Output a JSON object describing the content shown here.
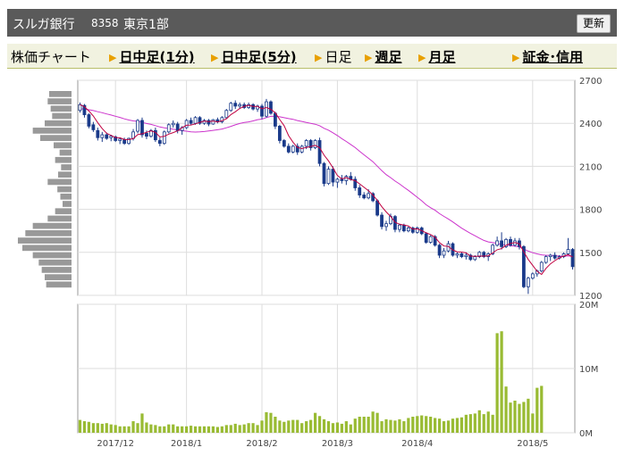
{
  "header": {
    "company": "スルガ銀行",
    "code": "8358",
    "market": "東京1部",
    "refresh_label": "更新"
  },
  "tabs": [
    {
      "label": "株価チャート",
      "link": false
    },
    {
      "label": "日中足(1分)",
      "link": true
    },
    {
      "label": "日中足(5分)",
      "link": true
    },
    {
      "label": "日足",
      "link": false
    },
    {
      "label": "週足",
      "link": true
    },
    {
      "label": "月足",
      "link": true
    },
    {
      "label": "証金･信用",
      "link": true
    }
  ],
  "colors": {
    "up": "#ffffff",
    "down": "#1a3a8a",
    "candle_border": "#1a3a8a",
    "ma_short": "#c00040",
    "ma_long": "#cc33cc",
    "volume": "#99bb33",
    "volume_profile": "#999999"
  },
  "chart_data": [
    {
      "type": "candlestick",
      "price_axis": {
        "min": 1200,
        "max": 2700,
        "ticks": [
          "2700",
          "2400",
          "2100",
          "1800",
          "1500",
          "1200"
        ]
      },
      "x_tick_labels": [
        "2017/12",
        "2018/1",
        "2018/2",
        "2018/3",
        "2018/4",
        "2018/5"
      ],
      "x_tick_positions": [
        8,
        24,
        41,
        58,
        76,
        102
      ],
      "candles": [
        {
          "o": 2490,
          "h": 2545,
          "l": 2475,
          "c": 2530
        },
        {
          "o": 2525,
          "h": 2535,
          "l": 2440,
          "c": 2460
        },
        {
          "o": 2460,
          "h": 2470,
          "l": 2365,
          "c": 2380
        },
        {
          "o": 2390,
          "h": 2410,
          "l": 2340,
          "c": 2355
        },
        {
          "o": 2350,
          "h": 2370,
          "l": 2280,
          "c": 2300
        },
        {
          "o": 2300,
          "h": 2340,
          "l": 2270,
          "c": 2320
        },
        {
          "o": 2320,
          "h": 2335,
          "l": 2285,
          "c": 2295
        },
        {
          "o": 2300,
          "h": 2320,
          "l": 2275,
          "c": 2310
        },
        {
          "o": 2305,
          "h": 2315,
          "l": 2270,
          "c": 2280
        },
        {
          "o": 2280,
          "h": 2300,
          "l": 2255,
          "c": 2290
        },
        {
          "o": 2285,
          "h": 2300,
          "l": 2250,
          "c": 2260
        },
        {
          "o": 2260,
          "h": 2300,
          "l": 2250,
          "c": 2295
        },
        {
          "o": 2295,
          "h": 2360,
          "l": 2280,
          "c": 2340
        },
        {
          "o": 2345,
          "h": 2430,
          "l": 2330,
          "c": 2420
        },
        {
          "o": 2420,
          "h": 2440,
          "l": 2300,
          "c": 2320
        },
        {
          "o": 2330,
          "h": 2350,
          "l": 2290,
          "c": 2310
        },
        {
          "o": 2310,
          "h": 2360,
          "l": 2300,
          "c": 2350
        },
        {
          "o": 2350,
          "h": 2370,
          "l": 2270,
          "c": 2285
        },
        {
          "o": 2280,
          "h": 2300,
          "l": 2240,
          "c": 2260
        },
        {
          "o": 2260,
          "h": 2350,
          "l": 2250,
          "c": 2340
        },
        {
          "o": 2340,
          "h": 2400,
          "l": 2330,
          "c": 2390
        },
        {
          "o": 2390,
          "h": 2420,
          "l": 2370,
          "c": 2400
        },
        {
          "o": 2395,
          "h": 2410,
          "l": 2330,
          "c": 2350
        },
        {
          "o": 2350,
          "h": 2380,
          "l": 2320,
          "c": 2370
        },
        {
          "o": 2370,
          "h": 2430,
          "l": 2360,
          "c": 2420
        },
        {
          "o": 2420,
          "h": 2440,
          "l": 2390,
          "c": 2400
        },
        {
          "o": 2400,
          "h": 2450,
          "l": 2390,
          "c": 2440
        },
        {
          "o": 2440,
          "h": 2450,
          "l": 2390,
          "c": 2400
        },
        {
          "o": 2400,
          "h": 2430,
          "l": 2390,
          "c": 2420
        },
        {
          "o": 2420,
          "h": 2430,
          "l": 2380,
          "c": 2395
        },
        {
          "o": 2395,
          "h": 2430,
          "l": 2390,
          "c": 2425
        },
        {
          "o": 2425,
          "h": 2440,
          "l": 2400,
          "c": 2410
        },
        {
          "o": 2410,
          "h": 2450,
          "l": 2400,
          "c": 2440
        },
        {
          "o": 2440,
          "h": 2500,
          "l": 2430,
          "c": 2490
        },
        {
          "o": 2490,
          "h": 2550,
          "l": 2480,
          "c": 2540
        },
        {
          "o": 2540,
          "h": 2560,
          "l": 2500,
          "c": 2520
        },
        {
          "o": 2520,
          "h": 2545,
          "l": 2500,
          "c": 2530
        },
        {
          "o": 2530,
          "h": 2545,
          "l": 2500,
          "c": 2510
        },
        {
          "o": 2510,
          "h": 2545,
          "l": 2500,
          "c": 2530
        },
        {
          "o": 2530,
          "h": 2540,
          "l": 2490,
          "c": 2500
        },
        {
          "o": 2500,
          "h": 2530,
          "l": 2480,
          "c": 2520
        },
        {
          "o": 2520,
          "h": 2535,
          "l": 2430,
          "c": 2450
        },
        {
          "o": 2450,
          "h": 2570,
          "l": 2440,
          "c": 2550
        },
        {
          "o": 2550,
          "h": 2560,
          "l": 2460,
          "c": 2470
        },
        {
          "o": 2470,
          "h": 2480,
          "l": 2360,
          "c": 2380
        },
        {
          "o": 2380,
          "h": 2390,
          "l": 2260,
          "c": 2280
        },
        {
          "o": 2280,
          "h": 2290,
          "l": 2230,
          "c": 2240
        },
        {
          "o": 2240,
          "h": 2260,
          "l": 2190,
          "c": 2200
        },
        {
          "o": 2200,
          "h": 2250,
          "l": 2190,
          "c": 2240
        },
        {
          "o": 2240,
          "h": 2260,
          "l": 2180,
          "c": 2200
        },
        {
          "o": 2200,
          "h": 2250,
          "l": 2190,
          "c": 2240
        },
        {
          "o": 2240,
          "h": 2290,
          "l": 2220,
          "c": 2280
        },
        {
          "o": 2280,
          "h": 2290,
          "l": 2210,
          "c": 2230
        },
        {
          "o": 2230,
          "h": 2290,
          "l": 2220,
          "c": 2280
        },
        {
          "o": 2280,
          "h": 2300,
          "l": 2100,
          "c": 2120
        },
        {
          "o": 2120,
          "h": 2130,
          "l": 1960,
          "c": 1980
        },
        {
          "o": 1980,
          "h": 2100,
          "l": 1970,
          "c": 2080
        },
        {
          "o": 2080,
          "h": 2100,
          "l": 1960,
          "c": 1990
        },
        {
          "o": 1990,
          "h": 2020,
          "l": 1950,
          "c": 2010
        },
        {
          "o": 2010,
          "h": 2040,
          "l": 1980,
          "c": 2000
        },
        {
          "o": 2000,
          "h": 2040,
          "l": 1970,
          "c": 2030
        },
        {
          "o": 2030,
          "h": 2060,
          "l": 2000,
          "c": 2010
        },
        {
          "o": 2010,
          "h": 2030,
          "l": 1930,
          "c": 1950
        },
        {
          "o": 1950,
          "h": 1970,
          "l": 1880,
          "c": 1900
        },
        {
          "o": 1900,
          "h": 1920,
          "l": 1870,
          "c": 1880
        },
        {
          "o": 1880,
          "h": 1940,
          "l": 1870,
          "c": 1910
        },
        {
          "o": 1910,
          "h": 1920,
          "l": 1850,
          "c": 1860
        },
        {
          "o": 1860,
          "h": 1870,
          "l": 1750,
          "c": 1760
        },
        {
          "o": 1760,
          "h": 1780,
          "l": 1660,
          "c": 1680
        },
        {
          "o": 1680,
          "h": 1720,
          "l": 1650,
          "c": 1700
        },
        {
          "o": 1700,
          "h": 1770,
          "l": 1690,
          "c": 1750
        },
        {
          "o": 1750,
          "h": 1760,
          "l": 1640,
          "c": 1660
        },
        {
          "o": 1660,
          "h": 1700,
          "l": 1640,
          "c": 1690
        },
        {
          "o": 1690,
          "h": 1700,
          "l": 1640,
          "c": 1650
        },
        {
          "o": 1650,
          "h": 1680,
          "l": 1640,
          "c": 1670
        },
        {
          "o": 1670,
          "h": 1680,
          "l": 1630,
          "c": 1640
        },
        {
          "o": 1640,
          "h": 1680,
          "l": 1630,
          "c": 1670
        },
        {
          "o": 1670,
          "h": 1680,
          "l": 1620,
          "c": 1630
        },
        {
          "o": 1630,
          "h": 1640,
          "l": 1560,
          "c": 1570
        },
        {
          "o": 1570,
          "h": 1620,
          "l": 1560,
          "c": 1610
        },
        {
          "o": 1610,
          "h": 1620,
          "l": 1540,
          "c": 1550
        },
        {
          "o": 1550,
          "h": 1560,
          "l": 1460,
          "c": 1480
        },
        {
          "o": 1480,
          "h": 1530,
          "l": 1460,
          "c": 1510
        },
        {
          "o": 1510,
          "h": 1580,
          "l": 1500,
          "c": 1560
        },
        {
          "o": 1560,
          "h": 1570,
          "l": 1470,
          "c": 1480
        },
        {
          "o": 1480,
          "h": 1500,
          "l": 1460,
          "c": 1490
        },
        {
          "o": 1490,
          "h": 1500,
          "l": 1460,
          "c": 1470
        },
        {
          "o": 1470,
          "h": 1500,
          "l": 1450,
          "c": 1480
        },
        {
          "o": 1480,
          "h": 1490,
          "l": 1440,
          "c": 1450
        },
        {
          "o": 1450,
          "h": 1480,
          "l": 1440,
          "c": 1470
        },
        {
          "o": 1470,
          "h": 1510,
          "l": 1460,
          "c": 1500
        },
        {
          "o": 1500,
          "h": 1510,
          "l": 1460,
          "c": 1470
        },
        {
          "o": 1470,
          "h": 1500,
          "l": 1440,
          "c": 1490
        },
        {
          "o": 1490,
          "h": 1560,
          "l": 1480,
          "c": 1550
        },
        {
          "o": 1550,
          "h": 1610,
          "l": 1540,
          "c": 1580
        },
        {
          "o": 1580,
          "h": 1640,
          "l": 1520,
          "c": 1540
        },
        {
          "o": 1540,
          "h": 1600,
          "l": 1530,
          "c": 1590
        },
        {
          "o": 1590,
          "h": 1610,
          "l": 1540,
          "c": 1550
        },
        {
          "o": 1550,
          "h": 1600,
          "l": 1540,
          "c": 1580
        },
        {
          "o": 1580,
          "h": 1600,
          "l": 1520,
          "c": 1540
        },
        {
          "o": 1540,
          "h": 1550,
          "l": 1250,
          "c": 1260
        },
        {
          "o": 1260,
          "h": 1330,
          "l": 1210,
          "c": 1320
        },
        {
          "o": 1320,
          "h": 1360,
          "l": 1310,
          "c": 1350
        },
        {
          "o": 1350,
          "h": 1380,
          "l": 1330,
          "c": 1370
        },
        {
          "o": 1370,
          "h": 1440,
          "l": 1360,
          "c": 1430
        },
        {
          "o": 1430,
          "h": 1480,
          "l": 1420,
          "c": 1470
        },
        {
          "o": 1470,
          "h": 1490,
          "l": 1440,
          "c": 1480
        },
        {
          "o": 1480,
          "h": 1500,
          "l": 1450,
          "c": 1460
        },
        {
          "o": 1460,
          "h": 1480,
          "l": 1450,
          "c": 1470
        },
        {
          "o": 1470,
          "h": 1500,
          "l": 1460,
          "c": 1490
        },
        {
          "o": 1490,
          "h": 1600,
          "l": 1480,
          "c": 1520
        },
        {
          "o": 1520,
          "h": 1530,
          "l": 1380,
          "c": 1400
        }
      ],
      "ma_short_period": 5,
      "ma_long_period": 25,
      "ma_long_start": 2500
    },
    {
      "type": "bar",
      "volume_axis": {
        "max": 20,
        "unit": "M",
        "ticks": [
          "20M",
          "10M",
          "0M"
        ]
      },
      "volumes": [
        2.0,
        1.8,
        1.7,
        1.5,
        1.5,
        1.4,
        1.5,
        1.3,
        1.2,
        1.0,
        1.0,
        1.0,
        1.8,
        1.5,
        3.0,
        1.6,
        1.3,
        1.2,
        1.0,
        1.0,
        1.3,
        1.3,
        1.0,
        1.0,
        1.0,
        1.1,
        1.0,
        1.0,
        1.0,
        1.0,
        1.0,
        0.9,
        1.0,
        1.2,
        1.2,
        1.4,
        1.2,
        1.3,
        1.5,
        1.5,
        1.2,
        1.9,
        3.2,
        3.1,
        2.5,
        1.9,
        1.7,
        1.9,
        2.0,
        2.0,
        1.5,
        1.8,
        2.0,
        3.1,
        2.6,
        2.1,
        1.8,
        1.5,
        1.6,
        1.4,
        1.8,
        1.3,
        2.2,
        2.5,
        2.5,
        2.5,
        3.3,
        3.1,
        1.8,
        2.1,
        2.0,
        1.9,
        2.1,
        1.8,
        2.3,
        2.5,
        2.6,
        2.7,
        2.6,
        2.5,
        2.3,
        2.2,
        1.8,
        1.9,
        2.2,
        2.3,
        2.4,
        2.8,
        2.9,
        3.0,
        3.5,
        2.9,
        3.3,
        2.8,
        15.5,
        15.8,
        7.2,
        4.7,
        5.0,
        4.5,
        4.8,
        5.3,
        3.0,
        7.0,
        7.3
      ],
      "volume_profile": [
        3,
        3.2,
        2.8,
        2.6,
        3.6,
        5.2,
        4.2,
        2.4,
        1.6,
        2.2,
        1.4,
        1.8,
        3.2,
        1.9,
        1.5,
        1.2,
        2.2,
        3.2,
        5.2,
        6.2,
        7.2,
        6.6,
        5.2,
        4.4,
        4.0,
        3.6,
        3.4
      ]
    }
  ]
}
